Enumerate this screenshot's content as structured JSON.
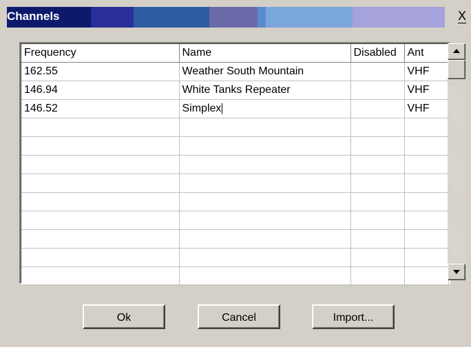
{
  "window": {
    "title": "Channels",
    "close_glyph": "X"
  },
  "grid": {
    "columns": [
      "Frequency",
      "Name",
      "Disabled",
      "Ant"
    ],
    "rows": [
      {
        "frequency": "162.55",
        "name": "Weather South Mountain",
        "disabled": "",
        "ant": "VHF"
      },
      {
        "frequency": "146.94",
        "name": "White Tanks Repeater",
        "disabled": "",
        "ant": "VHF"
      },
      {
        "frequency": "146.52",
        "name": "Simplex",
        "disabled": "",
        "ant": "VHF"
      }
    ],
    "empty_row_count": 9
  },
  "scrollbar": {
    "up_icon": "arrow-up-icon",
    "down_icon": "arrow-down-icon"
  },
  "buttons": {
    "ok": "Ok",
    "cancel": "Cancel",
    "import": "Import..."
  },
  "colors": {
    "title_text": "#ffffff",
    "face": "#d4d0c8"
  }
}
